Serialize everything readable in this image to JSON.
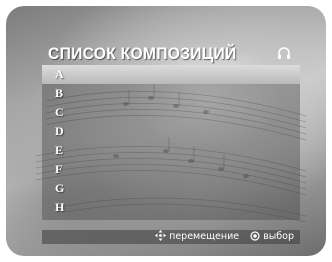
{
  "screen": {
    "title": "СПИСОК КОМПОЗИЦИЙ",
    "mode_icon": "headphones-icon"
  },
  "tracks": [
    {
      "label": "A",
      "selected": true
    },
    {
      "label": "B",
      "selected": false
    },
    {
      "label": "C",
      "selected": false
    },
    {
      "label": "D",
      "selected": false
    },
    {
      "label": "E",
      "selected": false
    },
    {
      "label": "F",
      "selected": false
    },
    {
      "label": "G",
      "selected": false
    },
    {
      "label": "H",
      "selected": false
    }
  ],
  "footer": {
    "move_icon": "four-way-arrows-icon",
    "move_label": "перемещение",
    "select_icon": "enter-button-icon",
    "select_label": "выбор"
  },
  "colors": {
    "highlight": "#c8c8c8",
    "text": "#ffffff"
  }
}
